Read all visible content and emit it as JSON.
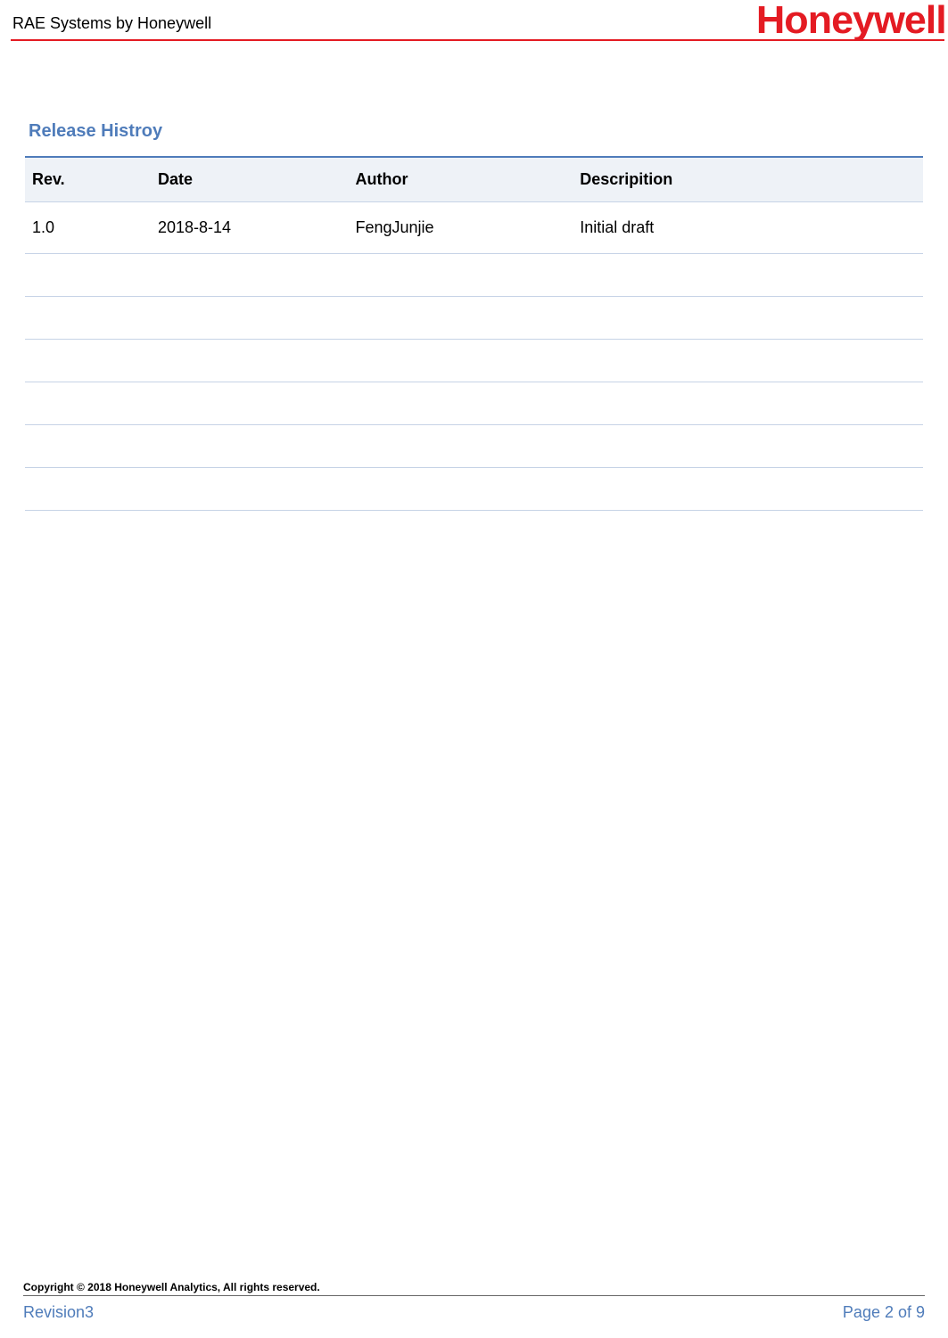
{
  "header": {
    "title": "RAE Systems by Honeywell",
    "logo": "Honeywell"
  },
  "section_title": "Release Histroy",
  "table": {
    "headers": [
      "Rev.",
      "Date",
      "Author",
      "Descripition"
    ],
    "rows": [
      {
        "rev": "1.0",
        "date": "2018-8-14",
        "author": "FengJunjie",
        "description": "Initial draft"
      },
      {
        "rev": "",
        "date": "",
        "author": "",
        "description": ""
      },
      {
        "rev": "",
        "date": "",
        "author": "",
        "description": ""
      },
      {
        "rev": "",
        "date": "",
        "author": "",
        "description": ""
      },
      {
        "rev": "",
        "date": "",
        "author": "",
        "description": ""
      },
      {
        "rev": "",
        "date": "",
        "author": "",
        "description": ""
      },
      {
        "rev": "",
        "date": "",
        "author": "",
        "description": ""
      }
    ]
  },
  "footer": {
    "copyright": "Copyright © 2018 Honeywell Analytics, All rights reserved.",
    "revision": "Revision3",
    "page": "Page 2 of 9"
  }
}
